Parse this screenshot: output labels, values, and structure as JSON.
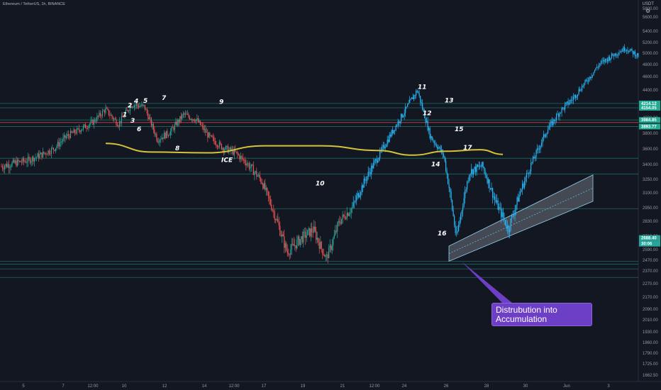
{
  "header": {
    "symbol_title": "Ethereum / TetherUS, 1h, BINANCE",
    "currency": "USDT"
  },
  "colors": {
    "background": "#131722",
    "up_candle": "#26a69a",
    "down_candle": "#ef5350",
    "later_candle": "#29b6f6",
    "ice_line": "#d4c33a",
    "level_line": "#22ab94",
    "resistance_line": "#e04d4d",
    "callout_bg": "#6c3fc6",
    "channel_fill": "#c8ccd4"
  },
  "chart_data": {
    "type": "candlestick",
    "ylim": [
      1600,
      5900
    ],
    "y_ticks": [
      "5800.00",
      "5600.00",
      "5400.00",
      "5200.00",
      "5000.00",
      "4800.00",
      "4600.00",
      "4400.00",
      "4200.00",
      "4000.00",
      "3800.00",
      "3600.00",
      "3400.00",
      "3250.00",
      "3100.00",
      "2950.00",
      "2830.00",
      "2710.00",
      "2590.00",
      "2470.00",
      "2370.00",
      "2270.00",
      "2170.00",
      "2090.00",
      "2010.00",
      "1930.00",
      "1860.00",
      "1790.00",
      "1725.00",
      "1662.50"
    ],
    "x_ticks": [
      "5",
      "7",
      "12:00",
      "10",
      "12",
      "14",
      "12:00",
      "17",
      "19",
      "21",
      "12:00",
      "24",
      "26",
      "28",
      "30",
      "Jun",
      "3"
    ],
    "price_labels": [
      {
        "label": "4214.12",
        "price": 4214,
        "color": "#22ab94"
      },
      {
        "label": "4154.05",
        "price": 4154,
        "color": "#22ab94"
      },
      {
        "label": "3984.85",
        "price": 3985,
        "color": "#22ab94"
      },
      {
        "label": "3893.77",
        "price": 3894,
        "color": "#22ab94"
      },
      {
        "label": "2688.40",
        "price": 2688,
        "color": "#26a69a"
      },
      {
        "label": "30:06",
        "price": 2640,
        "color": "#26a69a"
      }
    ],
    "horizontal_levels": [
      4214,
      4154,
      3985,
      3894,
      3480,
      3300,
      2950,
      2470,
      2440,
      2390,
      2320
    ],
    "resistance_level": 3950,
    "ice_line": {
      "label": "ICE",
      "points": [
        [
          0.0,
          3670
        ],
        [
          0.08,
          3560
        ],
        [
          0.18,
          3550
        ],
        [
          0.28,
          3640
        ],
        [
          0.38,
          3640
        ],
        [
          0.48,
          3580
        ],
        [
          0.54,
          3520
        ],
        [
          0.6,
          3570
        ],
        [
          0.66,
          3590
        ],
        [
          0.7,
          3530
        ]
      ]
    },
    "series_path": [
      3380,
      3420,
      3450,
      3520,
      3600,
      3760,
      3850,
      3950,
      4130,
      3930,
      4200,
      4170,
      3720,
      3820,
      4060,
      3990,
      3750,
      3620,
      3550,
      3400,
      3230,
      2900,
      2560,
      2680,
      2760,
      2500,
      2830,
      2960,
      3240,
      3500,
      3800,
      4100,
      4400,
      3760,
      3530,
      2680,
      3320,
      3390,
      3020,
      2760,
      3140,
      3490,
      3850,
      4110,
      4290,
      4540,
      4820,
      4960,
      5090,
      4960
    ],
    "wave_labels": [
      {
        "label": "1",
        "price": 4030
      },
      {
        "label": "2",
        "price": 4160
      },
      {
        "label": "3",
        "price": 3950
      },
      {
        "label": "4",
        "price": 4220
      },
      {
        "label": "5",
        "price": 4225
      },
      {
        "label": "6",
        "price": 3830
      },
      {
        "label": "7",
        "price": 4260
      },
      {
        "label": "8",
        "price": 3580
      },
      {
        "label": "9",
        "price": 4210
      },
      {
        "label": "10",
        "price": 3180
      },
      {
        "label": "11",
        "price": 4420
      },
      {
        "label": "12",
        "price": 4050
      },
      {
        "label": "13",
        "price": 4230
      },
      {
        "label": "14",
        "price": 3380
      },
      {
        "label": "15",
        "price": 3830
      },
      {
        "label": "16",
        "price": 2710
      },
      {
        "label": "17",
        "price": 3590
      }
    ],
    "channel": {
      "lower_start_price": 2470,
      "lower_end_price": 3020,
      "upper_start_price": 2620,
      "upper_end_price": 3290
    },
    "annotation": "Distrubution into Accumulation"
  }
}
